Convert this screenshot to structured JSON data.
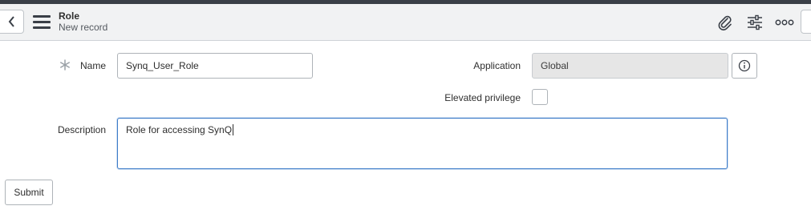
{
  "header": {
    "title": "Role",
    "subtitle": "New record",
    "icons": [
      "back-icon",
      "menu-icon",
      "attachment-icon",
      "settings-icon",
      "more-icon"
    ]
  },
  "form": {
    "name": {
      "label": "Name",
      "value": "Synq_User_Role",
      "required": true
    },
    "application": {
      "label": "Application",
      "value": "Global"
    },
    "elevated_privilege": {
      "label": "Elevated privilege",
      "checked": false
    },
    "description": {
      "label": "Description",
      "value": "Role for accessing SynQ"
    }
  },
  "actions": {
    "submit_label": "Submit"
  },
  "colors": {
    "header_bg": "#f1f2f3",
    "top_strip": "#3a3f47",
    "focus_border": "#3d7cc9",
    "readonly_bg": "#e6e6e6"
  }
}
